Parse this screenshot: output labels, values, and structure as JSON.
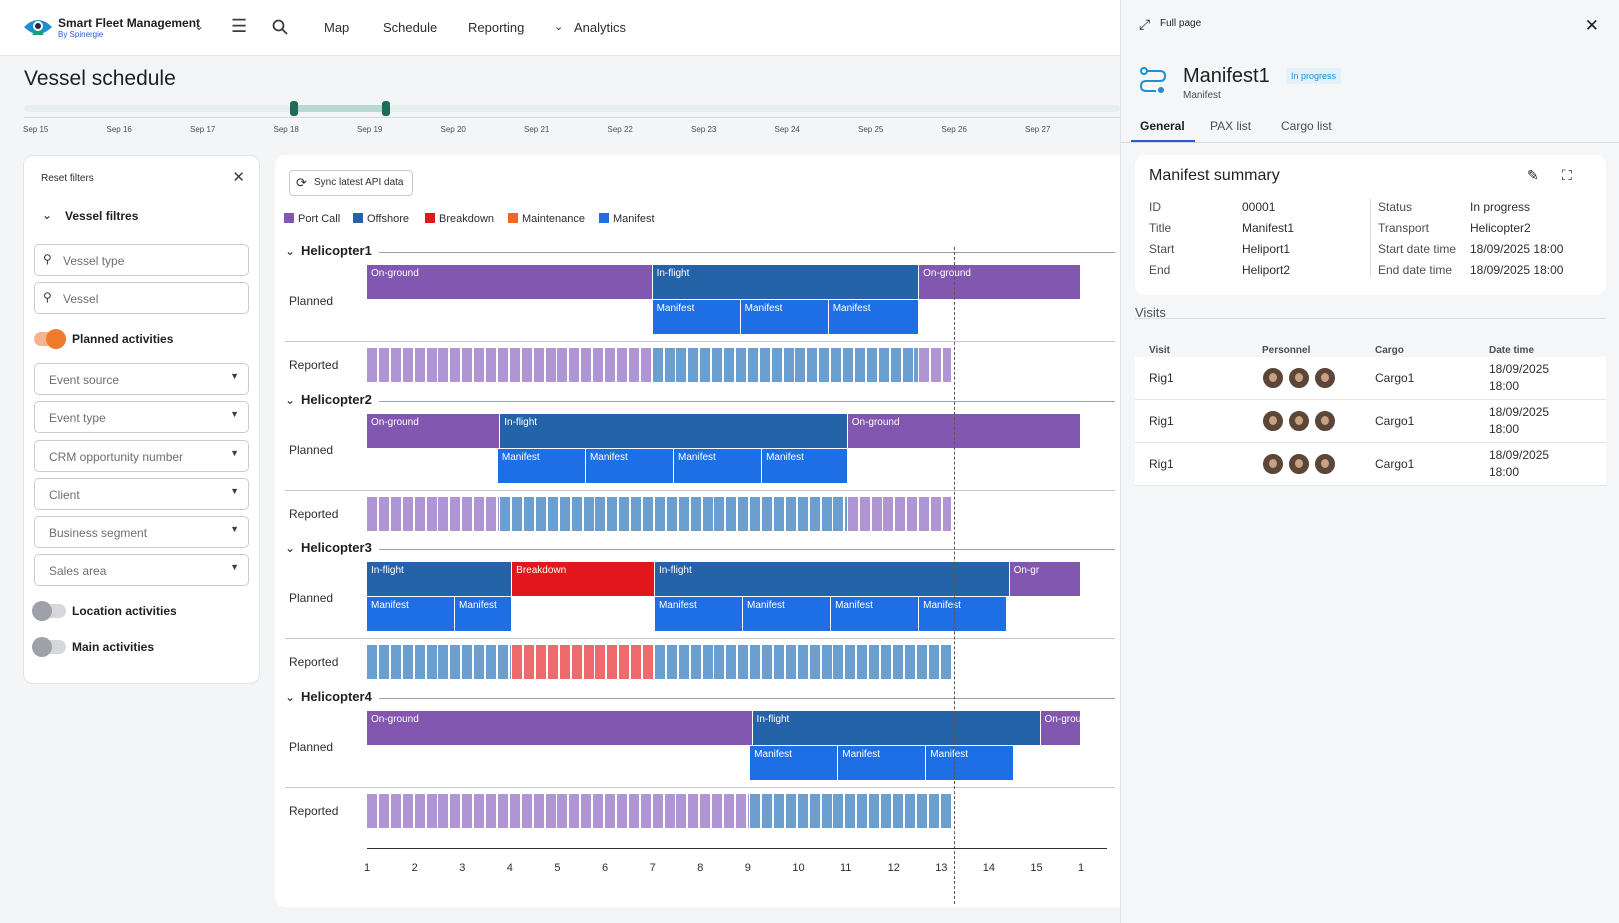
{
  "app": {
    "name": "Smart Fleet Management",
    "vendor": "By Spinergie"
  },
  "nav": {
    "map": "Map",
    "schedule": "Schedule",
    "reporting": "Reporting",
    "analytics": "Analytics"
  },
  "page": {
    "title": "Vessel schedule"
  },
  "timeline": {
    "dates": [
      "Sep 15",
      "Sep 16",
      "Sep 17",
      "Sep 18",
      "Sep 19",
      "Sep 20",
      "Sep 21",
      "Sep 22",
      "Sep 23",
      "Sep 24",
      "Sep 25",
      "Sep 26",
      "Sep 27"
    ]
  },
  "filters": {
    "reset": "Reset filters",
    "section": "Vessel filtres",
    "vessel_type": "Vessel type",
    "vessel": "Vessel",
    "planned": "Planned activities",
    "event_source": "Event source",
    "event_type": "Event type",
    "crm": "CRM opportunity number",
    "client": "Client",
    "business_segment": "Business segment",
    "sales_area": "Sales area",
    "location": "Location activities",
    "main": "Main activities"
  },
  "gantt": {
    "sync": "Sync latest API data",
    "legend": [
      {
        "label": "Port Call",
        "color": "#8157b0"
      },
      {
        "label": "Offshore",
        "color": "#2563a8"
      },
      {
        "label": "Breakdown",
        "color": "#e3171b"
      },
      {
        "label": "Maintenance",
        "color": "#f4661f"
      },
      {
        "label": "Manifest",
        "color": "#1e6fe6"
      }
    ],
    "planned_label": "Planned",
    "reported_label": "Reported",
    "x_labels": [
      "1",
      "2",
      "3",
      "4",
      "5",
      "6",
      "7",
      "8",
      "9",
      "10",
      "11",
      "12",
      "13",
      "14",
      "15",
      "1"
    ],
    "helicopters": [
      {
        "name": "Helicopter1",
        "planned": [
          {
            "label": "On-ground",
            "type": "port",
            "start": 1,
            "end": 7
          },
          {
            "label": "In-flight",
            "type": "offshore",
            "start": 7,
            "end": 12.6
          },
          {
            "label": "On-ground",
            "type": "port",
            "start": 12.6,
            "end": 16
          }
        ],
        "manifests": [
          {
            "label": "Manifest",
            "start": 7,
            "end": 8.85
          },
          {
            "label": "Manifest",
            "start": 8.85,
            "end": 10.7
          },
          {
            "label": "Manifest",
            "start": 10.7,
            "end": 12.6
          }
        ],
        "reported": [
          {
            "type": "port",
            "start": 1,
            "end": 7
          },
          {
            "type": "offshore",
            "start": 7,
            "end": 12.6
          },
          {
            "type": "port",
            "start": 12.6,
            "end": 13.3
          }
        ]
      },
      {
        "name": "Helicopter2",
        "planned": [
          {
            "label": "On-ground",
            "type": "port",
            "start": 1,
            "end": 3.8
          },
          {
            "label": "In-flight",
            "type": "offshore",
            "start": 3.8,
            "end": 11.1
          },
          {
            "label": "On-ground",
            "type": "port",
            "start": 11.1,
            "end": 16
          }
        ],
        "manifests": [
          {
            "label": "Manifest",
            "start": 3.75,
            "end": 5.6
          },
          {
            "label": "Manifest",
            "start": 5.6,
            "end": 7.45
          },
          {
            "label": "Manifest",
            "start": 7.45,
            "end": 9.3
          },
          {
            "label": "Manifest",
            "start": 9.3,
            "end": 11.1
          }
        ],
        "reported": [
          {
            "type": "port",
            "start": 1,
            "end": 3.8
          },
          {
            "type": "offshore",
            "start": 3.8,
            "end": 11.1
          },
          {
            "type": "port",
            "start": 11.1,
            "end": 13.3
          }
        ]
      },
      {
        "name": "Helicopter3",
        "planned": [
          {
            "label": "In-flight",
            "type": "offshore",
            "start": 1,
            "end": 4.05
          },
          {
            "label": "Breakdown",
            "type": "breakdown",
            "start": 4.05,
            "end": 7.05
          },
          {
            "label": "In-flight",
            "type": "offshore",
            "start": 7.05,
            "end": 14.5
          },
          {
            "label": "On-gr",
            "type": "port",
            "start": 14.5,
            "end": 16
          }
        ],
        "manifests": [
          {
            "label": "Manifest",
            "start": 1,
            "end": 2.85
          },
          {
            "label": "Manifest",
            "start": 2.85,
            "end": 4.05
          },
          {
            "label": "Manifest",
            "start": 7.05,
            "end": 8.9
          },
          {
            "label": "Manifest",
            "start": 8.9,
            "end": 10.75
          },
          {
            "label": "Manifest",
            "start": 10.75,
            "end": 12.6
          },
          {
            "label": "Manifest",
            "start": 12.6,
            "end": 14.45
          }
        ],
        "reported": [
          {
            "type": "offshore",
            "start": 1,
            "end": 4.05
          },
          {
            "type": "breakdown",
            "start": 4.05,
            "end": 7.05
          },
          {
            "type": "offshore",
            "start": 7.05,
            "end": 13.3
          }
        ]
      },
      {
        "name": "Helicopter4",
        "planned": [
          {
            "label": "On-ground",
            "type": "port",
            "start": 1,
            "end": 9.1
          },
          {
            "label": "In-flight",
            "type": "offshore",
            "start": 9.1,
            "end": 15.15
          },
          {
            "label": "On-grou",
            "type": "port",
            "start": 15.15,
            "end": 16
          }
        ],
        "manifests": [
          {
            "label": "Manifest",
            "start": 9.05,
            "end": 10.9
          },
          {
            "label": "Manifest",
            "start": 10.9,
            "end": 12.75
          },
          {
            "label": "Manifest",
            "start": 12.75,
            "end": 14.6
          }
        ],
        "reported": [
          {
            "type": "port",
            "start": 1,
            "end": 9.05
          },
          {
            "type": "offshore",
            "start": 9.05,
            "end": 13.3
          }
        ]
      }
    ]
  },
  "side": {
    "full_page": "Full page",
    "title": "Manifest1",
    "badge": "In progress",
    "subtitle": "Manifest",
    "tabs": [
      "General",
      "PAX list",
      "Cargo list"
    ],
    "summary": {
      "title": "Manifest summary",
      "left": [
        [
          "ID",
          "00001"
        ],
        [
          "Title",
          "Manifest1"
        ],
        [
          "Start",
          "Heliport1"
        ],
        [
          "End",
          "Heliport2"
        ]
      ],
      "right": [
        [
          "Status",
          "In progress"
        ],
        [
          "Transport",
          "Helicopter2"
        ],
        [
          "Start date time",
          "18/09/2025 18:00"
        ],
        [
          "End date time",
          "18/09/2025 18:00"
        ]
      ]
    },
    "visits": {
      "title": "Visits",
      "headers": [
        "Visit",
        "Personnel",
        "Cargo",
        "Date time"
      ],
      "rows": [
        {
          "visit": "Rig1",
          "cargo": "Cargo1",
          "date": "18/09/2025",
          "time": "18:00"
        },
        {
          "visit": "Rig1",
          "cargo": "Cargo1",
          "date": "18/09/2025",
          "time": "18:00"
        },
        {
          "visit": "Rig1",
          "cargo": "Cargo1",
          "date": "18/09/2025",
          "time": "18:00"
        }
      ]
    }
  }
}
